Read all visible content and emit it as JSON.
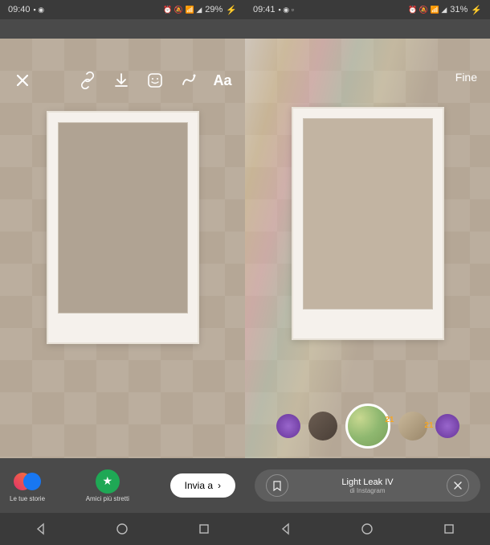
{
  "left": {
    "status": {
      "time": "09:40",
      "battery": "29%",
      "indicators": "⏰ 🔕 📶 ◢"
    },
    "toolbar": {
      "close": "close-icon",
      "actions": [
        "link-icon",
        "download-icon",
        "sticker-icon",
        "draw-icon"
      ],
      "text_tool": "Aa"
    },
    "bottom": {
      "your_stories": "Le tue storie",
      "close_friends": "Amici più stretti",
      "send_to": "Invia a"
    }
  },
  "right": {
    "status": {
      "time": "09:41",
      "battery": "31%",
      "indicators": "⏰ 🔕 📶 ◢"
    },
    "toolbar": {
      "done": "Fine"
    },
    "filters": {
      "badges": [
        "21",
        "21"
      ]
    },
    "info": {
      "title": "Light Leak IV",
      "subtitle": "di Instagram"
    }
  },
  "nav_icons": [
    "back",
    "home",
    "recent"
  ]
}
